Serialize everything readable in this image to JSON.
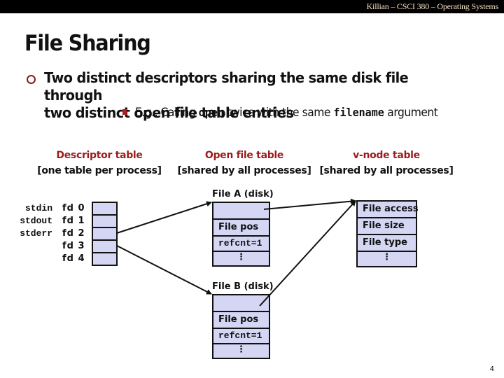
{
  "header": {
    "course_title": "Killian – CSCI 380 – Operating Systems"
  },
  "slide": {
    "title": "File Sharing",
    "bullet": {
      "line1": "Two distinct descriptors sharing the same disk file through",
      "line2": "two distinct open file table entries",
      "sub": {
        "prefix": "E.g., Calling ",
        "code1": "open",
        "middle": " twice with the same ",
        "code2": "filename",
        "suffix": " argument"
      }
    },
    "page_number": "4"
  },
  "colors": {
    "accent_red": "#9b1c1c",
    "box_fill": "#d4d6f3",
    "header_bg": "#000000",
    "header_text": "#f3e2c0"
  },
  "diagram": {
    "descriptor_table": {
      "heading": "Descriptor table",
      "subheading": "[one table per process]",
      "std_labels": [
        "stdin",
        "stdout",
        "stderr"
      ],
      "fd_labels": [
        "fd 0",
        "fd 1",
        "fd 2",
        "fd 3",
        "fd 4"
      ]
    },
    "open_file_table": {
      "heading": "Open file table",
      "subheading": "[shared by all processes]",
      "entries": [
        {
          "label": "File A (disk)",
          "pos": "File pos",
          "refcnt": "refcnt=1",
          "more": "⋮"
        },
        {
          "label": "File B (disk)",
          "pos": "File pos",
          "refcnt": "refcnt=1",
          "more": "⋮"
        }
      ]
    },
    "vnode_table": {
      "heading": "v-node table",
      "subheading": "[shared by all processes]",
      "rows": [
        "File access",
        "File size",
        "File type",
        "⋮"
      ]
    },
    "links": [
      {
        "from": "fd 3",
        "to": "File A (disk)"
      },
      {
        "from": "fd 4",
        "to": "File B (disk)"
      },
      {
        "from": "File A (disk)",
        "to": "v-node table"
      },
      {
        "from": "File B (disk)",
        "to": "v-node table"
      }
    ]
  }
}
